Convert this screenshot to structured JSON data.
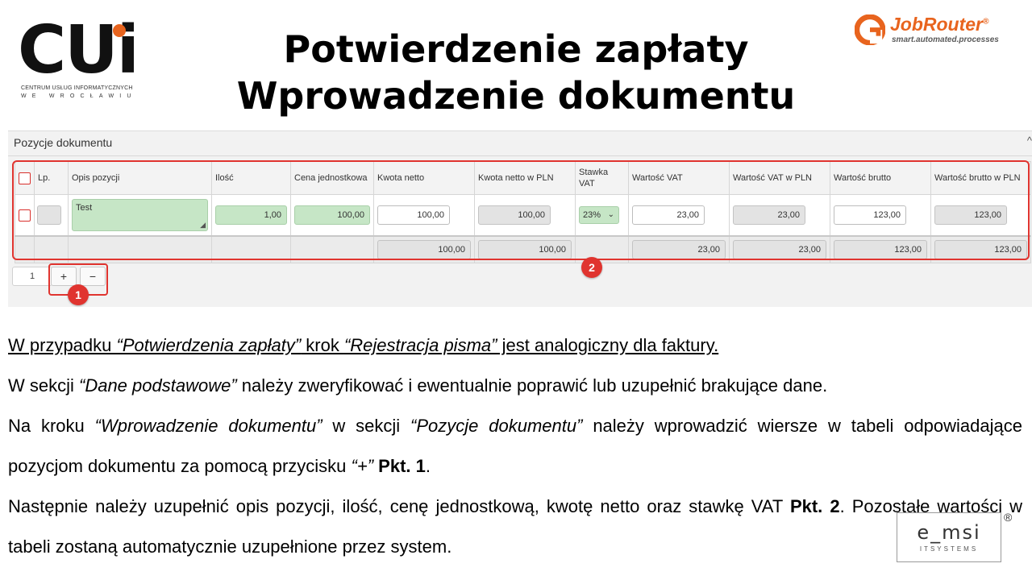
{
  "header": {
    "cui_logo": {
      "mark": "CUi",
      "line1": "CENTRUM USŁUG INFORMATYCZNYCH",
      "line2": "WE WROCŁAWIU"
    },
    "title_line1": "Potwierdzenie zapłaty",
    "title_line2": "Wprowadzenie dokumentu",
    "jobrouter_logo": {
      "name": "JobRouter",
      "reg": "®",
      "tagline": "smart.automated.processes",
      "accent": "#e8641e"
    }
  },
  "panel": {
    "title": "Pozycje dokumentu",
    "collapse_icon": "^",
    "columns": [
      "Lp.",
      "Opis pozycji",
      "Ilość",
      "Cena jednostkowa",
      "Kwota netto",
      "Kwota netto w PLN",
      "Stawka VAT",
      "Wartość VAT",
      "Wartość VAT w PLN",
      "Wartość brutto",
      "Wartość brutto w PLN"
    ],
    "row": {
      "lp": "",
      "opis": "Test",
      "ilosc": "1,00",
      "cena": "100,00",
      "kwota_netto": "100,00",
      "kwota_netto_pln": "100,00",
      "stawka_vat": "23%",
      "wartosc_vat": "23,00",
      "wartosc_vat_pln": "23,00",
      "wartosc_brutto": "123,00",
      "wartosc_brutto_pln": "123,00"
    },
    "totals": {
      "kwota_netto": "100,00",
      "kwota_netto_pln": "100,00",
      "wartosc_vat": "23,00",
      "wartosc_vat_pln": "23,00",
      "wartosc_brutto": "123,00",
      "wartosc_brutto_pln": "123,00"
    },
    "row_count": "1",
    "add_label": "+",
    "remove_label": "−",
    "badge1": "1",
    "badge2": "2",
    "highlight_color": "#e0342f"
  },
  "text": {
    "p1_a": "W przypadku ",
    "p1_b": "“Potwierdzenia zapłaty”",
    "p1_c": " krok ",
    "p1_d": "“Rejestracja pisma”",
    "p1_e": " jest analogiczny dla faktury.",
    "p2_a": "W sekcji ",
    "p2_b": "“Dane podstawowe”",
    "p2_c": " należy zweryfikować i ewentualnie poprawić lub uzupełnić brakujące dane.",
    "p3_a": "Na kroku ",
    "p3_b": "“Wprowadzenie dokumentu”",
    "p3_c": " w sekcji ",
    "p3_d": "“Pozycje dokumentu”",
    "p3_e": " należy wprowadzić wiersze w tabeli odpowiadające pozycjom dokumentu za pomocą przycisku ",
    "p3_f": "“+”",
    "p3_g": " ",
    "p3_h": "Pkt. 1",
    "p3_i": ".",
    "p4_a": "Następnie należy uzupełnić opis pozycji, ilość, cenę jednostkową, kwotę netto oraz stawkę VAT ",
    "p4_b": "Pkt. 2",
    "p4_c": ". Pozostałe wartości w tabeli zostaną automatycznie uzupełnione przez system."
  },
  "emsi_logo": {
    "main": "e_msi",
    "sub": "ITSYSTEMS",
    "reg": "®"
  }
}
